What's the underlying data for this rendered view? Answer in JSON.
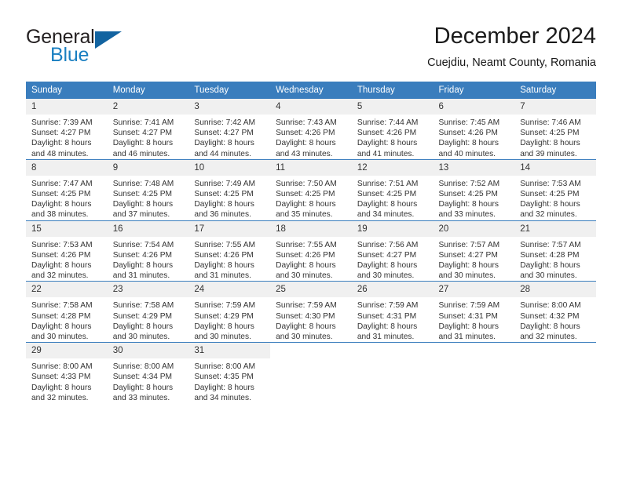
{
  "brand": {
    "name_part1": "General",
    "name_part2": "Blue",
    "triangle_color": "#1263a0",
    "blue_color": "#1a7fc1"
  },
  "header": {
    "title": "December 2024",
    "subtitle": "Cuejdiu, Neamt County, Romania"
  },
  "theme": {
    "header_bg": "#3a7dbd",
    "daynum_bg": "#f0f0f0",
    "text_color": "#333333"
  },
  "weekday_headers": [
    "Sunday",
    "Monday",
    "Tuesday",
    "Wednesday",
    "Thursday",
    "Friday",
    "Saturday"
  ],
  "weeks": [
    [
      {
        "day": "1",
        "sunrise": "Sunrise: 7:39 AM",
        "sunset": "Sunset: 4:27 PM",
        "daylight1": "Daylight: 8 hours",
        "daylight2": "and 48 minutes."
      },
      {
        "day": "2",
        "sunrise": "Sunrise: 7:41 AM",
        "sunset": "Sunset: 4:27 PM",
        "daylight1": "Daylight: 8 hours",
        "daylight2": "and 46 minutes."
      },
      {
        "day": "3",
        "sunrise": "Sunrise: 7:42 AM",
        "sunset": "Sunset: 4:27 PM",
        "daylight1": "Daylight: 8 hours",
        "daylight2": "and 44 minutes."
      },
      {
        "day": "4",
        "sunrise": "Sunrise: 7:43 AM",
        "sunset": "Sunset: 4:26 PM",
        "daylight1": "Daylight: 8 hours",
        "daylight2": "and 43 minutes."
      },
      {
        "day": "5",
        "sunrise": "Sunrise: 7:44 AM",
        "sunset": "Sunset: 4:26 PM",
        "daylight1": "Daylight: 8 hours",
        "daylight2": "and 41 minutes."
      },
      {
        "day": "6",
        "sunrise": "Sunrise: 7:45 AM",
        "sunset": "Sunset: 4:26 PM",
        "daylight1": "Daylight: 8 hours",
        "daylight2": "and 40 minutes."
      },
      {
        "day": "7",
        "sunrise": "Sunrise: 7:46 AM",
        "sunset": "Sunset: 4:25 PM",
        "daylight1": "Daylight: 8 hours",
        "daylight2": "and 39 minutes."
      }
    ],
    [
      {
        "day": "8",
        "sunrise": "Sunrise: 7:47 AM",
        "sunset": "Sunset: 4:25 PM",
        "daylight1": "Daylight: 8 hours",
        "daylight2": "and 38 minutes."
      },
      {
        "day": "9",
        "sunrise": "Sunrise: 7:48 AM",
        "sunset": "Sunset: 4:25 PM",
        "daylight1": "Daylight: 8 hours",
        "daylight2": "and 37 minutes."
      },
      {
        "day": "10",
        "sunrise": "Sunrise: 7:49 AM",
        "sunset": "Sunset: 4:25 PM",
        "daylight1": "Daylight: 8 hours",
        "daylight2": "and 36 minutes."
      },
      {
        "day": "11",
        "sunrise": "Sunrise: 7:50 AM",
        "sunset": "Sunset: 4:25 PM",
        "daylight1": "Daylight: 8 hours",
        "daylight2": "and 35 minutes."
      },
      {
        "day": "12",
        "sunrise": "Sunrise: 7:51 AM",
        "sunset": "Sunset: 4:25 PM",
        "daylight1": "Daylight: 8 hours",
        "daylight2": "and 34 minutes."
      },
      {
        "day": "13",
        "sunrise": "Sunrise: 7:52 AM",
        "sunset": "Sunset: 4:25 PM",
        "daylight1": "Daylight: 8 hours",
        "daylight2": "and 33 minutes."
      },
      {
        "day": "14",
        "sunrise": "Sunrise: 7:53 AM",
        "sunset": "Sunset: 4:25 PM",
        "daylight1": "Daylight: 8 hours",
        "daylight2": "and 32 minutes."
      }
    ],
    [
      {
        "day": "15",
        "sunrise": "Sunrise: 7:53 AM",
        "sunset": "Sunset: 4:26 PM",
        "daylight1": "Daylight: 8 hours",
        "daylight2": "and 32 minutes."
      },
      {
        "day": "16",
        "sunrise": "Sunrise: 7:54 AM",
        "sunset": "Sunset: 4:26 PM",
        "daylight1": "Daylight: 8 hours",
        "daylight2": "and 31 minutes."
      },
      {
        "day": "17",
        "sunrise": "Sunrise: 7:55 AM",
        "sunset": "Sunset: 4:26 PM",
        "daylight1": "Daylight: 8 hours",
        "daylight2": "and 31 minutes."
      },
      {
        "day": "18",
        "sunrise": "Sunrise: 7:55 AM",
        "sunset": "Sunset: 4:26 PM",
        "daylight1": "Daylight: 8 hours",
        "daylight2": "and 30 minutes."
      },
      {
        "day": "19",
        "sunrise": "Sunrise: 7:56 AM",
        "sunset": "Sunset: 4:27 PM",
        "daylight1": "Daylight: 8 hours",
        "daylight2": "and 30 minutes."
      },
      {
        "day": "20",
        "sunrise": "Sunrise: 7:57 AM",
        "sunset": "Sunset: 4:27 PM",
        "daylight1": "Daylight: 8 hours",
        "daylight2": "and 30 minutes."
      },
      {
        "day": "21",
        "sunrise": "Sunrise: 7:57 AM",
        "sunset": "Sunset: 4:28 PM",
        "daylight1": "Daylight: 8 hours",
        "daylight2": "and 30 minutes."
      }
    ],
    [
      {
        "day": "22",
        "sunrise": "Sunrise: 7:58 AM",
        "sunset": "Sunset: 4:28 PM",
        "daylight1": "Daylight: 8 hours",
        "daylight2": "and 30 minutes."
      },
      {
        "day": "23",
        "sunrise": "Sunrise: 7:58 AM",
        "sunset": "Sunset: 4:29 PM",
        "daylight1": "Daylight: 8 hours",
        "daylight2": "and 30 minutes."
      },
      {
        "day": "24",
        "sunrise": "Sunrise: 7:59 AM",
        "sunset": "Sunset: 4:29 PM",
        "daylight1": "Daylight: 8 hours",
        "daylight2": "and 30 minutes."
      },
      {
        "day": "25",
        "sunrise": "Sunrise: 7:59 AM",
        "sunset": "Sunset: 4:30 PM",
        "daylight1": "Daylight: 8 hours",
        "daylight2": "and 30 minutes."
      },
      {
        "day": "26",
        "sunrise": "Sunrise: 7:59 AM",
        "sunset": "Sunset: 4:31 PM",
        "daylight1": "Daylight: 8 hours",
        "daylight2": "and 31 minutes."
      },
      {
        "day": "27",
        "sunrise": "Sunrise: 7:59 AM",
        "sunset": "Sunset: 4:31 PM",
        "daylight1": "Daylight: 8 hours",
        "daylight2": "and 31 minutes."
      },
      {
        "day": "28",
        "sunrise": "Sunrise: 8:00 AM",
        "sunset": "Sunset: 4:32 PM",
        "daylight1": "Daylight: 8 hours",
        "daylight2": "and 32 minutes."
      }
    ],
    [
      {
        "day": "29",
        "sunrise": "Sunrise: 8:00 AM",
        "sunset": "Sunset: 4:33 PM",
        "daylight1": "Daylight: 8 hours",
        "daylight2": "and 32 minutes."
      },
      {
        "day": "30",
        "sunrise": "Sunrise: 8:00 AM",
        "sunset": "Sunset: 4:34 PM",
        "daylight1": "Daylight: 8 hours",
        "daylight2": "and 33 minutes."
      },
      {
        "day": "31",
        "sunrise": "Sunrise: 8:00 AM",
        "sunset": "Sunset: 4:35 PM",
        "daylight1": "Daylight: 8 hours",
        "daylight2": "and 34 minutes."
      },
      {
        "day": "",
        "sunrise": "",
        "sunset": "",
        "daylight1": "",
        "daylight2": ""
      },
      {
        "day": "",
        "sunrise": "",
        "sunset": "",
        "daylight1": "",
        "daylight2": ""
      },
      {
        "day": "",
        "sunrise": "",
        "sunset": "",
        "daylight1": "",
        "daylight2": ""
      },
      {
        "day": "",
        "sunrise": "",
        "sunset": "",
        "daylight1": "",
        "daylight2": ""
      }
    ]
  ]
}
